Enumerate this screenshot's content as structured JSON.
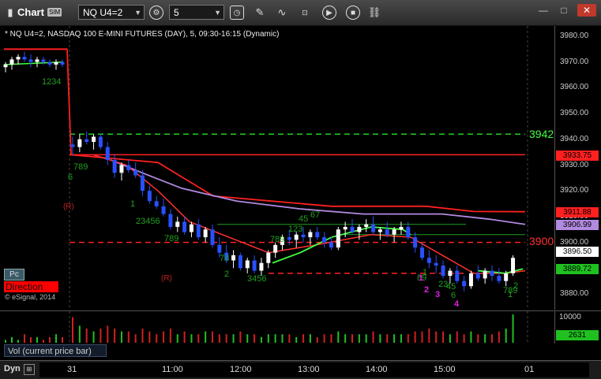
{
  "window": {
    "app_title": "Chart",
    "sim_badge": "SIM",
    "symbol": "NQ U4=2",
    "interval": "5"
  },
  "chart": {
    "title": "* NQ U4=2, NASDAQ 100 E-MINI FUTURES (DAY), 5, 09:30-16:15 (Dynamic)",
    "watermark": "© eSignal, 2014",
    "pc_badge": "Pc",
    "direction_badge": "Direction",
    "level_labels": [
      "3942",
      "3900"
    ],
    "r_markers": [
      "(R)",
      "(R)"
    ],
    "count_labels": [
      "1234",
      "6",
      "789",
      "1",
      "23456",
      "789",
      "78",
      "2",
      "3456",
      "789",
      "123",
      "45",
      "67",
      "89",
      "1",
      "23",
      "45",
      "6",
      "789",
      "1",
      "2",
      "3"
    ],
    "count_labels_magenta": [
      "1",
      "2",
      "3",
      "4"
    ]
  },
  "price_axis": {
    "ticks": [
      "3980.00",
      "3970.00",
      "3960.00",
      "3950.00",
      "3940.00",
      "3930.00",
      "3920.00",
      "3910.00",
      "3900.00",
      "3890.00",
      "3880.00"
    ],
    "badges": [
      {
        "value": "3933.75",
        "bg": "#ff2020",
        "fg": "#000000"
      },
      {
        "value": "3911.88",
        "bg": "#ff2020",
        "fg": "#000000"
      },
      {
        "value": "3906.99",
        "bg": "#b28ae0",
        "fg": "#000000"
      },
      {
        "value": "3896.50",
        "bg": "#ffffff",
        "fg": "#000000"
      },
      {
        "value": "3889.72",
        "bg": "#20c020",
        "fg": "#000000"
      }
    ]
  },
  "volume": {
    "label": "Vol (current price bar)",
    "ticks": [
      "10000"
    ],
    "current": "2631"
  },
  "time_axis": {
    "dyn": "Dyn",
    "labels": [
      "31",
      "11:00",
      "12:00",
      "13:00",
      "14:00",
      "15:00",
      "01"
    ]
  },
  "colors": {
    "up_candle": "#ffffff",
    "down_candle": "#2850ff",
    "resistance": "#ff2020",
    "support_green": "#20d020",
    "ma_purple": "#b28ae0",
    "ma_green": "#40ff40"
  },
  "chart_data": {
    "type": "candlestick",
    "y_range": [
      3875,
      3985
    ],
    "levels": [
      {
        "price": 3942,
        "style": "dashed",
        "color": "green"
      },
      {
        "price": 3934,
        "style": "solid",
        "color": "red"
      },
      {
        "price": 3900,
        "style": "dashed",
        "color": "red"
      },
      {
        "price": 3888,
        "style": "dashed",
        "color": "red"
      }
    ],
    "candles": [
      [
        3968,
        3970,
        3966,
        3969
      ],
      [
        3969,
        3972,
        3967,
        3971
      ],
      [
        3971,
        3973,
        3969,
        3972
      ],
      [
        3972,
        3974,
        3970,
        3971
      ],
      [
        3971,
        3973,
        3968,
        3970
      ],
      [
        3970,
        3972,
        3968,
        3971
      ],
      [
        3971,
        3972,
        3969,
        3970
      ],
      [
        3970,
        3971,
        3968,
        3969
      ],
      [
        3969,
        3971,
        3967,
        3970
      ],
      [
        3970,
        3971,
        3968,
        3969
      ],
      [
        3938,
        3941,
        3934,
        3937
      ],
      [
        3937,
        3942,
        3935,
        3940
      ],
      [
        3940,
        3943,
        3938,
        3939
      ],
      [
        3939,
        3942,
        3936,
        3941
      ],
      [
        3941,
        3942,
        3936,
        3937
      ],
      [
        3937,
        3939,
        3930,
        3932
      ],
      [
        3932,
        3934,
        3925,
        3927
      ],
      [
        3927,
        3931,
        3924,
        3930
      ],
      [
        3930,
        3932,
        3927,
        3928
      ],
      [
        3928,
        3931,
        3925,
        3926
      ],
      [
        3926,
        3928,
        3918,
        3920
      ],
      [
        3920,
        3922,
        3915,
        3916
      ],
      [
        3916,
        3918,
        3913,
        3914
      ],
      [
        3914,
        3917,
        3910,
        3911
      ],
      [
        3911,
        3913,
        3905,
        3906
      ],
      [
        3906,
        3910,
        3904,
        3908
      ],
      [
        3908,
        3910,
        3903,
        3904
      ],
      [
        3904,
        3908,
        3902,
        3907
      ],
      [
        3907,
        3909,
        3901,
        3902
      ],
      [
        3902,
        3906,
        3900,
        3905
      ],
      [
        3905,
        3907,
        3898,
        3899
      ],
      [
        3899,
        3902,
        3894,
        3896
      ],
      [
        3896,
        3899,
        3892,
        3893
      ],
      [
        3893,
        3897,
        3890,
        3895
      ],
      [
        3895,
        3896,
        3889,
        3890
      ],
      [
        3890,
        3894,
        3888,
        3893
      ],
      [
        3893,
        3895,
        3888,
        3889
      ],
      [
        3889,
        3894,
        3887,
        3892
      ],
      [
        3892,
        3897,
        3890,
        3896
      ],
      [
        3896,
        3900,
        3894,
        3899
      ],
      [
        3899,
        3903,
        3897,
        3902
      ],
      [
        3902,
        3905,
        3899,
        3901
      ],
      [
        3901,
        3904,
        3898,
        3903
      ],
      [
        3903,
        3906,
        3900,
        3902
      ],
      [
        3902,
        3905,
        3899,
        3904
      ],
      [
        3904,
        3906,
        3901,
        3902
      ],
      [
        3902,
        3904,
        3898,
        3900
      ],
      [
        3900,
        3902,
        3897,
        3898
      ],
      [
        3898,
        3906,
        3897,
        3905
      ],
      [
        3905,
        3908,
        3902,
        3906
      ],
      [
        3906,
        3909,
        3903,
        3904
      ],
      [
        3904,
        3907,
        3901,
        3906
      ],
      [
        3906,
        3909,
        3904,
        3907
      ],
      [
        3907,
        3910,
        3903,
        3904
      ],
      [
        3904,
        3906,
        3901,
        3905
      ],
      [
        3905,
        3908,
        3902,
        3903
      ],
      [
        3903,
        3906,
        3900,
        3905
      ],
      [
        3905,
        3908,
        3903,
        3906
      ],
      [
        3906,
        3908,
        3901,
        3902
      ],
      [
        3902,
        3904,
        3896,
        3898
      ],
      [
        3898,
        3900,
        3893,
        3894
      ],
      [
        3894,
        3897,
        3890,
        3892
      ],
      [
        3892,
        3895,
        3888,
        3891
      ],
      [
        3891,
        3893,
        3886,
        3887
      ],
      [
        3887,
        3890,
        3884,
        3889
      ],
      [
        3889,
        3891,
        3884,
        3885
      ],
      [
        3885,
        3887,
        3881,
        3883
      ],
      [
        3883,
        3889,
        3882,
        3888
      ],
      [
        3888,
        3891,
        3885,
        3886
      ],
      [
        3886,
        3890,
        3884,
        3889
      ],
      [
        3889,
        3891,
        3885,
        3887
      ],
      [
        3887,
        3890,
        3884,
        3885
      ],
      [
        3885,
        3889,
        3883,
        3888
      ],
      [
        3888,
        3895,
        3887,
        3894
      ]
    ],
    "volume": [
      1,
      2,
      1,
      3,
      2,
      2,
      1,
      2,
      3,
      2,
      9,
      6,
      5,
      4,
      5,
      6,
      5,
      4,
      4,
      3,
      5,
      4,
      3,
      4,
      5,
      3,
      4,
      3,
      3,
      4,
      4,
      3,
      3,
      3,
      4,
      3,
      3,
      2,
      3,
      3,
      3,
      3,
      2,
      3,
      3,
      2,
      3,
      3,
      4,
      3,
      3,
      3,
      3,
      4,
      3,
      3,
      3,
      3,
      3,
      4,
      4,
      5,
      4,
      4,
      3,
      4,
      3,
      4,
      3,
      3,
      3,
      4,
      5,
      10
    ]
  }
}
